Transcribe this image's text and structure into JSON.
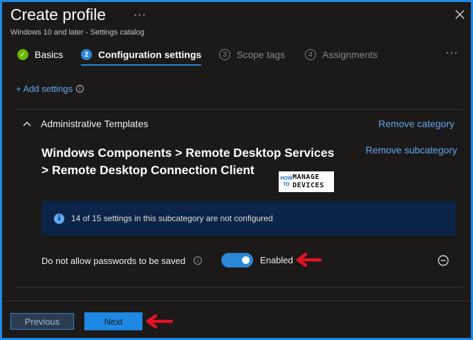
{
  "header": {
    "title": "Create profile",
    "more_label": "···",
    "subtitle": "Windows 10 and later - Settings catalog"
  },
  "wizard": {
    "steps": [
      {
        "number": "✓",
        "label": "Basics",
        "state": "done"
      },
      {
        "number": "2",
        "label": "Configuration settings",
        "state": "active"
      },
      {
        "number": "3",
        "label": "Scope tags",
        "state": "todo"
      },
      {
        "number": "4",
        "label": "Assignments",
        "state": "todo"
      }
    ],
    "more_label": "···"
  },
  "add_settings": {
    "label": "+ Add settings",
    "info": "i"
  },
  "category": {
    "name": "Administrative Templates",
    "remove_label": "Remove category",
    "subcategory_line1": "Windows Components > Remote Desktop Services",
    "subcategory_line2": "> Remote Desktop Connection Client",
    "remove_sub_label": "Remove subcategory"
  },
  "logo": {
    "how": "HOW",
    "to": "TO",
    "manage": "MANAGE",
    "devices": "DEVICES"
  },
  "banner": {
    "icon": "i",
    "text": "14 of 15 settings in this subcategory are not configured"
  },
  "setting": {
    "label": "Do not allow passwords to be saved",
    "info": "i",
    "toggle_on": true,
    "state_label": "Enabled"
  },
  "footer": {
    "previous_label": "Previous",
    "next_label": "Next"
  },
  "colors": {
    "accent": "#2b88d8",
    "link": "#62a9f0",
    "success": "#6bb700",
    "banner_bg": "#0b2447",
    "annotation_arrow": "#e81123",
    "frame_border": "#1e88e5"
  }
}
